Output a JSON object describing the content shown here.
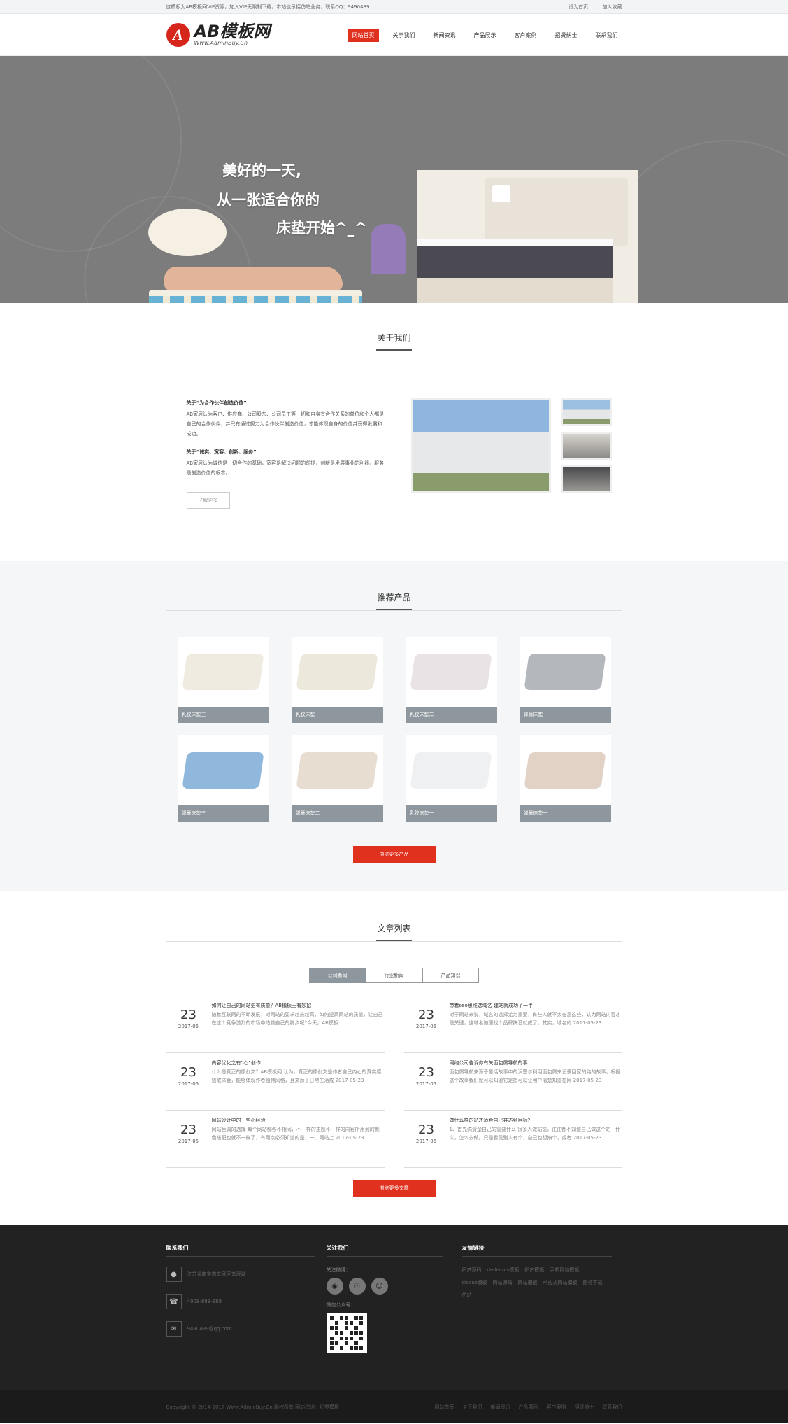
{
  "topbar": {
    "notice": "这模板为AB模板网VIP资源，加入VIP无限制下载，本站也承接仿站业务，联系QQ：9490489",
    "links": [
      "设为首页",
      "加入收藏"
    ]
  },
  "header": {
    "logo_mark": "A",
    "logo_main": "AB模板网",
    "logo_sub": "Www.AdminBuy.Cn",
    "nav": [
      "网站首页",
      "关于我们",
      "新闻资讯",
      "产品展示",
      "客户案例",
      "招贤纳士",
      "联系我们"
    ]
  },
  "banner": {
    "slogan1": "美好的一天,",
    "slogan2": "从一张适合你的",
    "slogan3": "床垫开始^_^",
    "slides": 3,
    "active_slide": 3
  },
  "about": {
    "title": "关于我们",
    "h1": "关于“为合作伙伴创造价值”",
    "p1": "AB家居认为客户、供应商、公司股东、公司员工等一切和自身有合作关系的单位和个人都是自己的合作伙伴，并只有通过努力为合作伙伴创造价值，才能体现自身的价值并获得发展和成功。",
    "h2": "关于“诚实、宽容、创新、服务”",
    "p2": "AB家居认为诚信是一切合作的基础，宽容是解决问题的前提，创新是发展事业的利器，服务是创造价值的根本。",
    "more": "了解更多"
  },
  "products": {
    "title": "推荐产品",
    "items": [
      {
        "name": "乳胶床垫三",
        "color": "#efebe0"
      },
      {
        "name": "乳胶床垫",
        "color": "#ece8dc"
      },
      {
        "name": "乳胶床垫二",
        "color": "#e9e3e6"
      },
      {
        "name": "弹簧床垫",
        "color": "#b4b8bd"
      },
      {
        "name": "弹簧床垫三",
        "color": "#8fb8dc"
      },
      {
        "name": "弹簧床垫二",
        "color": "#e8ddd1"
      },
      {
        "name": "乳胶床垫一",
        "color": "#eef0f2"
      },
      {
        "name": "弹簧床垫一",
        "color": "#e2d2c6"
      }
    ],
    "more": "浏览更多产品"
  },
  "articles": {
    "title": "文章列表",
    "tabs": [
      "公司新闻",
      "行业新闻",
      "产品知识"
    ],
    "items": [
      {
        "day": "23",
        "ym": "2017-05",
        "title": "如何让自己的网站更有质量？AB模板王有妙招",
        "desc": "随着互联网的不断发展，对网站的要求越来越高，如何提高网站的质量，让自己在这个竞争激烈的市场中站稳自己的脚步呢?今天，AB模板"
      },
      {
        "day": "23",
        "ym": "2017-05",
        "title": "带着seo思维选域名 建站就成功了一半",
        "desc": "对于网站来说，域名的选择尤为重要，有些人就不太在意这些，认为网站内容才是关键，这域名随便找个品牌拼音就成了。其实，域名的 2017-05-23"
      },
      {
        "day": "23",
        "ym": "2017-05",
        "title": "内容优化之有“心”创作",
        "desc": "什么是真正的原创文？AB模板网 认为，真正的原创文是作者自己内心的真实感悟或体会，能够体现作者独特风格，且来源于日常生活或 2017-05-23"
      },
      {
        "day": "23",
        "ym": "2017-05",
        "title": "网络公司告诉你有关面包屑导航的事",
        "desc": "面包屑导航来源于童话故事中的汉塞尔利用面包屑来记录回家的路的故事，根据这个故事我们就可以知道它是指可以让用户清楚知道在网 2017-05-23"
      },
      {
        "day": "23",
        "ym": "2017-05",
        "title": "网站设计中的一些小经验",
        "desc": "网站色调的选择 每个网站都各不相同，不一样的主题不一样的内容所用到的颜色搭配也就不一样了，有两点必须知道的是，一、网站上 2017-05-23"
      },
      {
        "day": "23",
        "ym": "2017-05",
        "title": "做什么样的站才适合自己并达到目标?",
        "desc": "1、首先搞清楚自己的需要什么 很多人做站前，往往都不知道自己做这个站干什么，怎么去做。只是看见别人有个，自己也想搞个，或者 2017-05-23"
      }
    ],
    "more": "浏览更多文章"
  },
  "footer": {
    "contact_title": "联系我们",
    "address": "江苏省南京市玄武区玄武湖",
    "phone": "4008-888-888",
    "email": "9490489@qq.com",
    "follow_title": "关注我们",
    "follow_label": "关注微博：",
    "wechat_label": "微信公众号：",
    "links_title": "友情链接",
    "links": [
      "织梦源码",
      "dedecms模板",
      "织梦模板",
      "手机网站模板",
      "discuz模板",
      "网站源码",
      "网站模板",
      "响应式网站模板",
      "图标下载",
      "仿站"
    ],
    "copyright": "Copyright © 2014-2017 Www.AdminBuy.Cn 版权所有  网站建设：织梦模板",
    "bottom_nav": [
      "网站首页",
      "关于我们",
      "新闻资讯",
      "产品展示",
      "客户案例",
      "招贤纳士",
      "联系我们"
    ]
  }
}
